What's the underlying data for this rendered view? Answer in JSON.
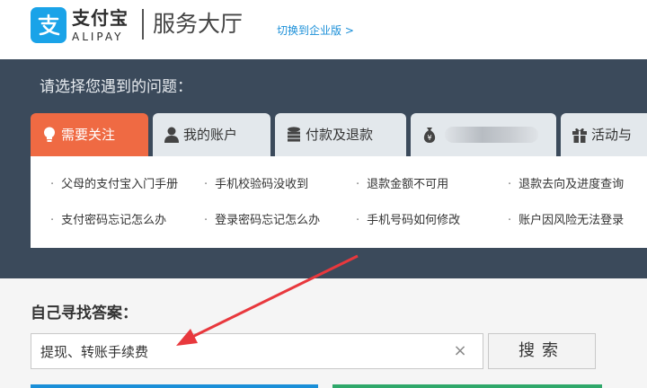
{
  "header": {
    "brand_cn": "支付宝",
    "brand_en": "ALIPAY",
    "page_title": "服务大厅",
    "switch_link": "切换到企业版 >"
  },
  "panel": {
    "title": "请选择您遇到的问题：",
    "tabs": [
      {
        "label": "需要关注",
        "icon": "lightbulb-icon",
        "active": true
      },
      {
        "label": "我的账户",
        "icon": "user-icon",
        "active": false
      },
      {
        "label": "付款及退款",
        "icon": "database-icon",
        "active": false
      },
      {
        "label": "",
        "icon": "money-bag-icon",
        "active": false
      },
      {
        "label": "活动与",
        "icon": "gift-icon",
        "active": false
      }
    ],
    "questions": [
      [
        "父母的支付宝入门手册",
        "手机校验码没收到",
        "退款金额不可用",
        "退款去向及进度查询"
      ],
      [
        "支付密码忘记怎么办",
        "登录密码忘记怎么办",
        "手机号码如何修改",
        "账户因风险无法登录"
      ]
    ]
  },
  "search": {
    "title": "自己寻找答案：",
    "value": "提现、转账手续费",
    "clear_symbol": "×",
    "button_label": "搜索"
  },
  "colors": {
    "accent_orange": "#ef6a43",
    "panel_bg": "#3b4a5b",
    "link_blue": "#1a8fd8",
    "arrow_red": "#e8383d"
  }
}
